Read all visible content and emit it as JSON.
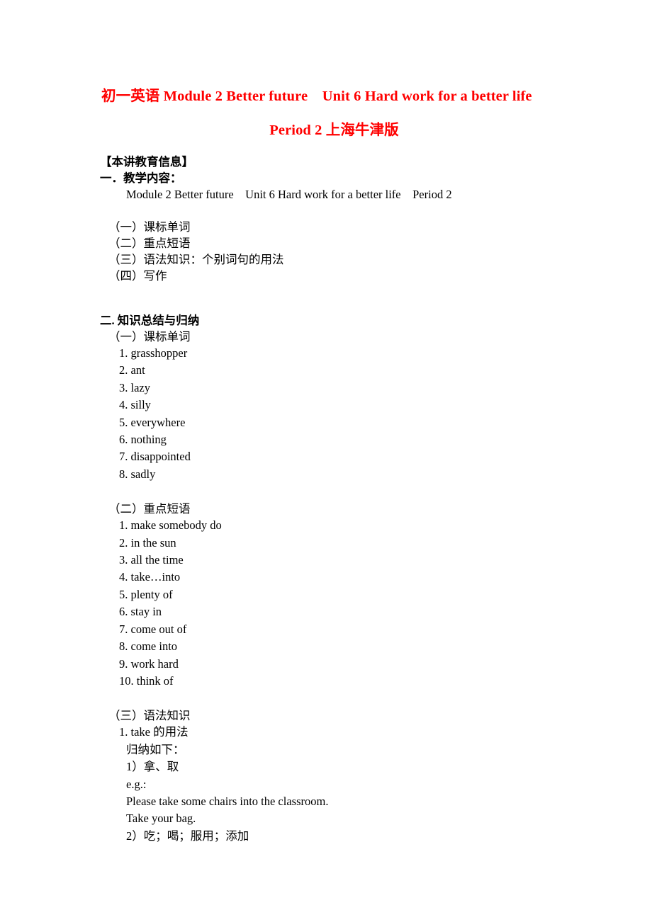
{
  "document": {
    "title_lines": [
      "初一英语 Module 2 Better future Unit 6 Hard work for a better life",
      "Period 2 上海牛津版"
    ],
    "title_color": "#ff0000",
    "info_heading": "【本讲教育信息】",
    "section_one": {
      "heading": "一．教学内容：",
      "content_line": "Module 2 Better future Unit 6 Hard work for a better life Period 2",
      "outline": [
        "（一）课标单词",
        "（二）重点短语",
        "（三）语法知识：个别词句的用法",
        "（四）写作"
      ]
    },
    "section_two": {
      "heading": "二. 知识总结与归纳",
      "part_one": {
        "heading": "（一）课标单词",
        "items": [
          "1. grasshopper",
          "2. ant",
          "3. lazy",
          "4. silly",
          "5. everywhere",
          "6. nothing",
          "7. disappointed",
          "8. sadly"
        ]
      },
      "part_two": {
        "heading": "（二）重点短语",
        "items": [
          "1. make somebody do",
          "2. in the sun",
          "3. all the time",
          "4. take…into",
          "5. plenty of",
          "6. stay in",
          "7. come out of",
          "8. come into",
          "9. work hard",
          "10. think of"
        ]
      },
      "part_three": {
        "heading": "（三）语法知识",
        "entry_label": "1. take 的用法",
        "summary_label": "归纳如下：",
        "usages": [
          {
            "label": "1）拿、取",
            "eg_label": "e.g.:",
            "examples": [
              "Please take some chairs into the classroom.",
              "Take your bag."
            ]
          },
          {
            "label": "2）吃；喝；服用；添加",
            "eg_label": "",
            "examples": []
          }
        ]
      }
    }
  }
}
